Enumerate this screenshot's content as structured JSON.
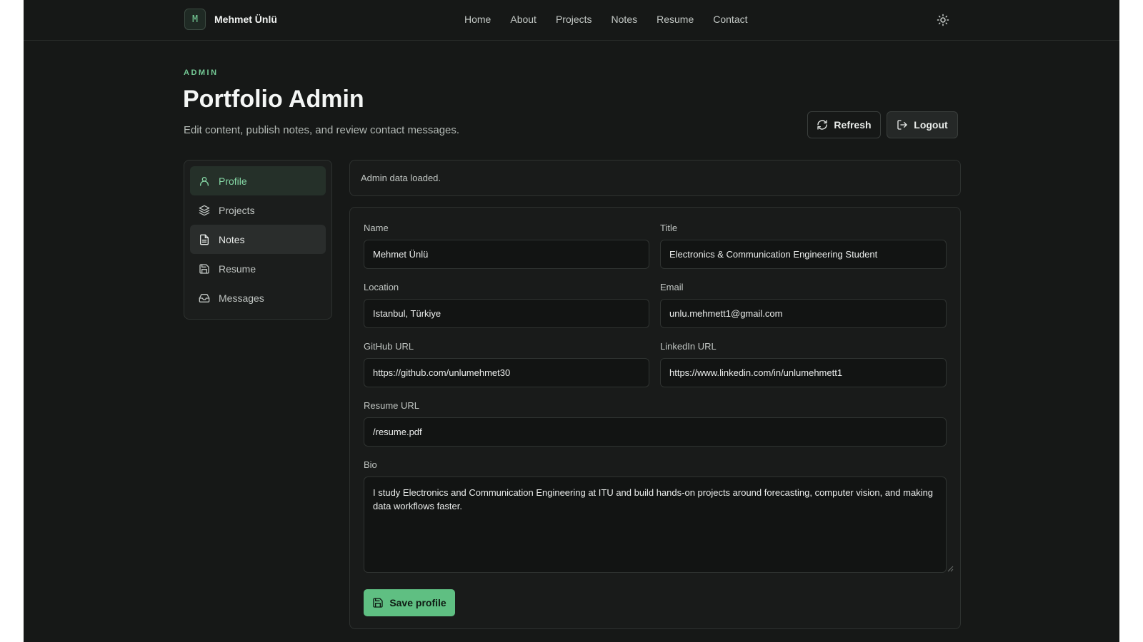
{
  "brand": {
    "logo_letter": "M",
    "name": "Mehmet Ünlü"
  },
  "nav": [
    {
      "label": "Home"
    },
    {
      "label": "About"
    },
    {
      "label": "Projects"
    },
    {
      "label": "Notes"
    },
    {
      "label": "Resume"
    },
    {
      "label": "Contact"
    }
  ],
  "header": {
    "eyebrow": "ADMIN",
    "title": "Portfolio Admin",
    "subtitle": "Edit content, publish notes, and review contact messages.",
    "refresh_label": "Refresh",
    "logout_label": "Logout"
  },
  "sidebar": {
    "items": [
      {
        "label": "Profile",
        "icon": "user-icon",
        "state": "active"
      },
      {
        "label": "Projects",
        "icon": "layers-icon",
        "state": "normal"
      },
      {
        "label": "Notes",
        "icon": "file-text-icon",
        "state": "hover"
      },
      {
        "label": "Resume",
        "icon": "save-icon",
        "state": "normal"
      },
      {
        "label": "Messages",
        "icon": "inbox-icon",
        "state": "normal"
      }
    ]
  },
  "status": {
    "text": "Admin data loaded."
  },
  "form": {
    "name_label": "Name",
    "name_value": "Mehmet Ünlü",
    "title_label": "Title",
    "title_value": "Electronics & Communication Engineering Student",
    "location_label": "Location",
    "location_value": "Istanbul, Türkiye",
    "email_label": "Email",
    "email_value": "unlu.mehmett1@gmail.com",
    "github_label": "GitHub URL",
    "github_value": "https://github.com/unlumehmet30",
    "linkedin_label": "LinkedIn URL",
    "linkedin_value": "https://www.linkedin.com/in/unlumehmett1",
    "resume_label": "Resume URL",
    "resume_value": "/resume.pdf",
    "bio_label": "Bio",
    "bio_value": "I study Electronics and Communication Engineering at ITU and build hands-on projects around forecasting, computer vision, and making data workflows faster.",
    "save_label": "Save profile"
  },
  "colors": {
    "background": "#161817",
    "accent": "#5fbf82",
    "accent_text": "#74c995",
    "surface": "#191b1a",
    "border": "#2e3230"
  }
}
